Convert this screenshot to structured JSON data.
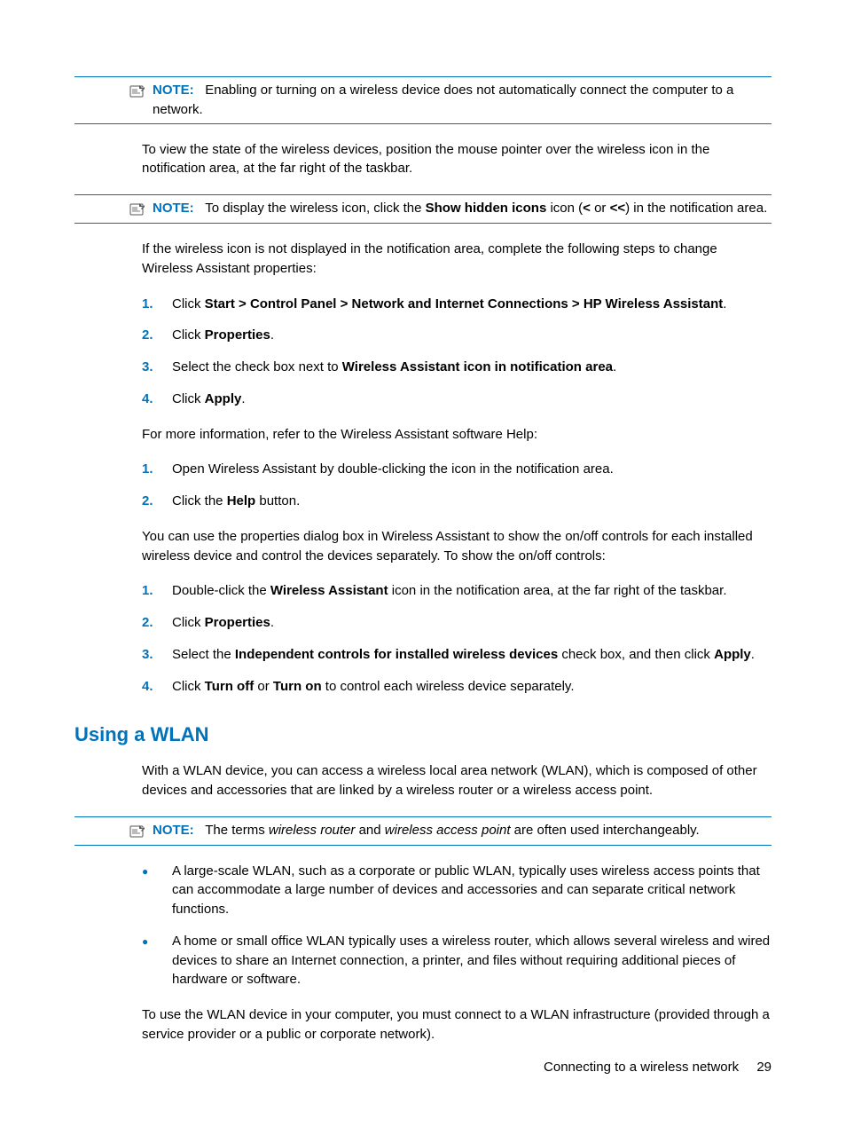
{
  "notes": {
    "label": "NOTE:",
    "n1": "Enabling or turning on a wireless device does not automatically connect the computer to a network.",
    "n2_pre": "To display the wireless icon, click the ",
    "n2_bold1": "Show hidden icons",
    "n2_mid1": " icon (",
    "n2_bold2": "<",
    "n2_mid2": " or ",
    "n2_bold3": "<<",
    "n2_post": ") in the notification area.",
    "n3_pre": "The terms ",
    "n3_i1": "wireless router",
    "n3_mid": " and ",
    "n3_i2": "wireless access point",
    "n3_post": " are often used interchangeably."
  },
  "paras": {
    "p1": "To view the state of the wireless devices, position the mouse pointer over the wireless icon in the notification area, at the far right of the taskbar.",
    "p2": "If the wireless icon is not displayed in the notification area, complete the following steps to change Wireless Assistant properties:",
    "p3": "For more information, refer to the Wireless Assistant software Help:",
    "p4": "You can use the properties dialog box in Wireless Assistant to show the on/off controls for each installed wireless device and control the devices separately. To show the on/off controls:",
    "p5": "With a WLAN device, you can access a wireless local area network (WLAN), which is composed of other devices and accessories that are linked by a wireless router or a wireless access point.",
    "p6": "To use the WLAN device in your computer, you must connect to a WLAN infrastructure (provided through a service provider or a public or corporate network)."
  },
  "list1": {
    "i1_pre": "Click ",
    "i1_b": "Start > Control Panel > Network and Internet Connections > HP Wireless Assistant",
    "i1_post": ".",
    "i2_pre": "Click ",
    "i2_b": "Properties",
    "i2_post": ".",
    "i3_pre": "Select the check box next to ",
    "i3_b": "Wireless Assistant icon in notification area",
    "i3_post": ".",
    "i4_pre": "Click ",
    "i4_b": "Apply",
    "i4_post": "."
  },
  "list2": {
    "i1": "Open Wireless Assistant by double-clicking the icon in the notification area.",
    "i2_pre": "Click the ",
    "i2_b": "Help",
    "i2_post": " button."
  },
  "list3": {
    "i1_pre": "Double-click the ",
    "i1_b": "Wireless Assistant",
    "i1_post": " icon in the notification area, at the far right of the taskbar.",
    "i2_pre": "Click ",
    "i2_b": "Properties",
    "i2_post": ".",
    "i3_pre": "Select the ",
    "i3_b": "Independent controls for installed wireless devices",
    "i3_mid": " check box, and then click ",
    "i3_b2": "Apply",
    "i3_post": ".",
    "i4_pre": "Click ",
    "i4_b1": "Turn off",
    "i4_mid": " or ",
    "i4_b2": "Turn on",
    "i4_post": " to control each wireless device separately."
  },
  "bullets": {
    "b1": "A large-scale WLAN, such as a corporate or public WLAN, typically uses wireless access points that can accommodate a large number of devices and accessories and can separate critical network functions.",
    "b2": "A home or small office WLAN typically uses a wireless router, which allows several wireless and wired devices to share an Internet connection, a printer, and files without requiring additional pieces of hardware or software."
  },
  "heading": "Using a WLAN",
  "footer": {
    "section": "Connecting to a wireless network",
    "page": "29"
  },
  "nums": {
    "n1": "1.",
    "n2": "2.",
    "n3": "3.",
    "n4": "4."
  },
  "bullet_char": "●"
}
